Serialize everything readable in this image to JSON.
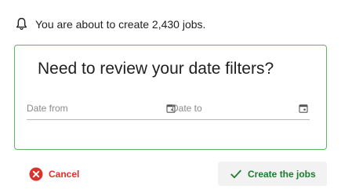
{
  "notice": {
    "text": "You are about to create 2,430 jobs.",
    "icon": "bell-icon"
  },
  "card": {
    "title": "Need to review your date filters?",
    "date_from": {
      "placeholder": "Date from",
      "icon": "calendar-icon"
    },
    "date_to": {
      "placeholder": "Date to",
      "icon": "calendar-icon"
    }
  },
  "actions": {
    "cancel_label": "Cancel",
    "cancel_icon": "close-circle-icon",
    "create_label": "Create the jobs",
    "create_icon": "checkmark-icon"
  },
  "colors": {
    "card_border": "#5fb665",
    "cancel": "#d9342b",
    "create": "#1e7a2e",
    "create_bg": "#f2f2f2"
  }
}
